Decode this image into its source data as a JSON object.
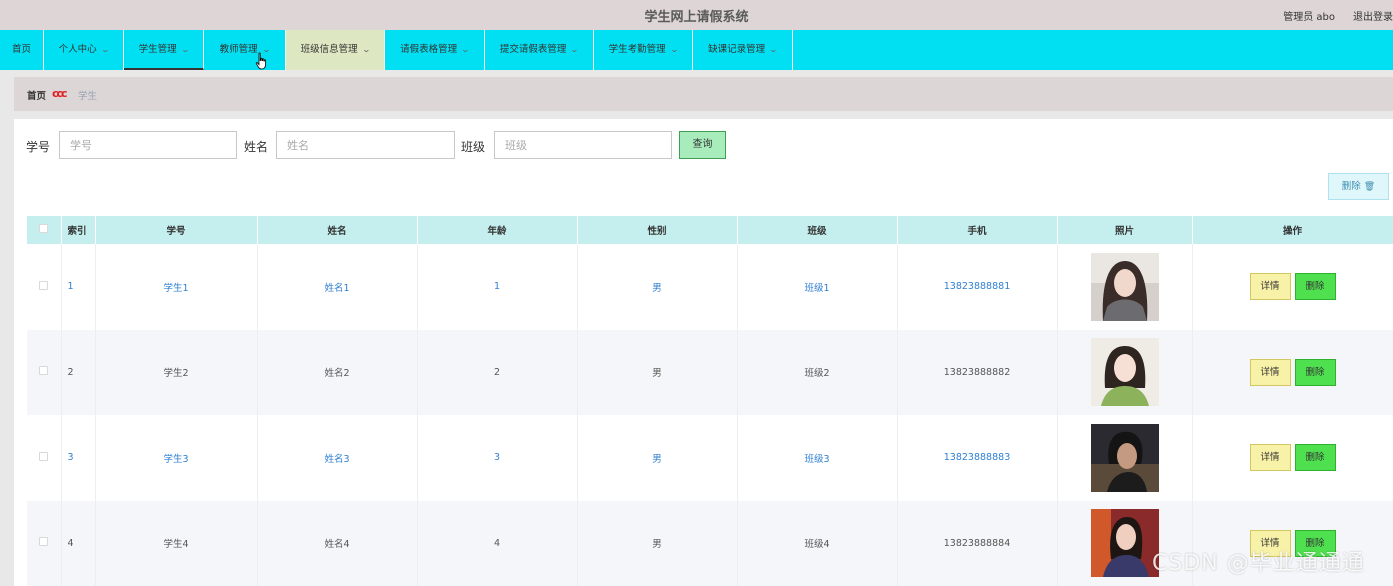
{
  "app": {
    "title": "学生网上请假系统",
    "user_text": "管理员 abo",
    "logout_label": "退出登录"
  },
  "nav": {
    "items": [
      {
        "label": "首页",
        "chevron": false
      },
      {
        "label": "个人中心",
        "chevron": true
      },
      {
        "label": "学生管理",
        "chevron": true,
        "active": true
      },
      {
        "label": "教师管理",
        "chevron": true,
        "hovered": true
      },
      {
        "label": "班级信息管理",
        "chevron": true,
        "highlighted": true
      },
      {
        "label": "请假表格管理",
        "chevron": true
      },
      {
        "label": "提交请假表管理",
        "chevron": true
      },
      {
        "label": "学生考勤管理",
        "chevron": true
      },
      {
        "label": "缺课记录管理",
        "chevron": true
      }
    ]
  },
  "breadcrumb": {
    "home": "首页",
    "separator": "ccc",
    "current": "学生"
  },
  "search": {
    "fields": [
      {
        "label": "学号",
        "placeholder": "学号"
      },
      {
        "label": "姓名",
        "placeholder": "姓名"
      },
      {
        "label": "班级",
        "placeholder": "班级"
      }
    ],
    "query_label": "查询"
  },
  "toolbar": {
    "delete_label": "删除"
  },
  "table": {
    "columns": [
      "索引",
      "学号",
      "姓名",
      "年龄",
      "性别",
      "班级",
      "手机",
      "照片",
      "操作"
    ],
    "rows": [
      {
        "index": "1",
        "student_no": "学生1",
        "name": "姓名1",
        "age": "1",
        "gender": "男",
        "class": "班级1",
        "phone": "13823888881"
      },
      {
        "index": "2",
        "student_no": "学生2",
        "name": "姓名2",
        "age": "2",
        "gender": "男",
        "class": "班级2",
        "phone": "13823888882"
      },
      {
        "index": "3",
        "student_no": "学生3",
        "name": "姓名3",
        "age": "3",
        "gender": "男",
        "class": "班级3",
        "phone": "13823888883"
      },
      {
        "index": "4",
        "student_no": "学生4",
        "name": "姓名4",
        "age": "4",
        "gender": "男",
        "class": "班级4",
        "phone": "13823888884"
      }
    ],
    "detail_label": "详情",
    "delete_label": "删除"
  },
  "watermark": "CSDN @毕业通通通",
  "colors": {
    "nav_bg": "#00e0f2",
    "header_row_bg": "#c4efee",
    "link_blue": "#2f7fd0",
    "detail_btn": "#f8f1a8",
    "delete_btn": "#4fe04f",
    "query_btn": "#a8ecbc"
  }
}
